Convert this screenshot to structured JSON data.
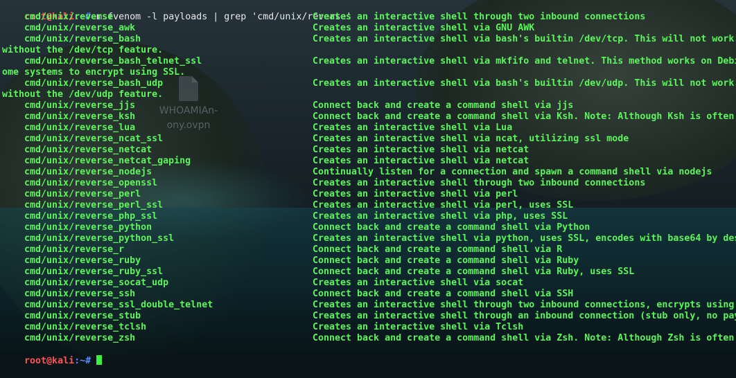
{
  "desktop_icon": {
    "label_lines": [
      "WHOAMIAn-",
      "ony.ovpn"
    ]
  },
  "terminal": {
    "prompt_user": "root@kali",
    "prompt_path": ":~#",
    "command": " msfvenom -l payloads | grep 'cmd/unix/reverse'",
    "lines": [
      {
        "payload": "    cmd/unix/reverse",
        "description": "Creates an interactive shell through two inbound connections"
      },
      {
        "payload": "    cmd/unix/reverse_awk",
        "description": "Creates an interactive shell via GNU AWK"
      },
      {
        "payload": "    cmd/unix/reverse_bash",
        "description": "Creates an interactive shell via bash's builtin /dev/tcp. This will not work"
      },
      {
        "wrap": "without the /dev/tcp feature."
      },
      {
        "payload": "    cmd/unix/reverse_bash_telnet_ssl",
        "description": "Creates an interactive shell via mkfifo and telnet. This method works on Debi"
      },
      {
        "wrap": "ome systems to encrypt using SSL."
      },
      {
        "payload": "    cmd/unix/reverse_bash_udp",
        "description": "Creates an interactive shell via bash's builtin /dev/udp. This will not work"
      },
      {
        "wrap": "without the /dev/udp feature."
      },
      {
        "payload": "    cmd/unix/reverse_jjs",
        "description": "Connect back and create a command shell via jjs"
      },
      {
        "payload": "    cmd/unix/reverse_ksh",
        "description": "Connect back and create a command shell via Ksh. Note: Although Ksh is often"
      },
      {
        "payload": "    cmd/unix/reverse_lua",
        "description": "Creates an interactive shell via Lua"
      },
      {
        "payload": "    cmd/unix/reverse_ncat_ssl",
        "description": "Creates an interactive shell via ncat, utilizing ssl mode"
      },
      {
        "payload": "    cmd/unix/reverse_netcat",
        "description": "Creates an interactive shell via netcat"
      },
      {
        "payload": "    cmd/unix/reverse_netcat_gaping",
        "description": "Creates an interactive shell via netcat"
      },
      {
        "payload": "    cmd/unix/reverse_nodejs",
        "description": "Continually listen for a connection and spawn a command shell via nodejs"
      },
      {
        "payload": "    cmd/unix/reverse_openssl",
        "description": "Creates an interactive shell through two inbound connections"
      },
      {
        "payload": "    cmd/unix/reverse_perl",
        "description": "Creates an interactive shell via perl"
      },
      {
        "payload": "    cmd/unix/reverse_perl_ssl",
        "description": "Creates an interactive shell via perl, uses SSL"
      },
      {
        "payload": "    cmd/unix/reverse_php_ssl",
        "description": "Creates an interactive shell via php, uses SSL"
      },
      {
        "payload": "    cmd/unix/reverse_python",
        "description": "Connect back and create a command shell via Python"
      },
      {
        "payload": "    cmd/unix/reverse_python_ssl",
        "description": "Creates an interactive shell via python, uses SSL, encodes with base64 by des"
      },
      {
        "payload": "    cmd/unix/reverse_r",
        "description": "Connect back and create a command shell via R"
      },
      {
        "payload": "    cmd/unix/reverse_ruby",
        "description": "Connect back and create a command shell via Ruby"
      },
      {
        "payload": "    cmd/unix/reverse_ruby_ssl",
        "description": "Connect back and create a command shell via Ruby, uses SSL"
      },
      {
        "payload": "    cmd/unix/reverse_socat_udp",
        "description": "Creates an interactive shell via socat"
      },
      {
        "payload": "    cmd/unix/reverse_ssh",
        "description": "Connect back and create a command shell via SSH"
      },
      {
        "payload": "    cmd/unix/reverse_ssl_double_telnet",
        "description": "Creates an interactive shell through two inbound connections, encrypts using"
      },
      {
        "payload": "    cmd/unix/reverse_stub",
        "description": "Creates an interactive shell through an inbound connection (stub only, no pay"
      },
      {
        "payload": "    cmd/unix/reverse_tclsh",
        "description": "Creates an interactive shell via Tclsh"
      },
      {
        "payload": "    cmd/unix/reverse_zsh",
        "description": "Connect back and create a command shell via Zsh. Note: Although Zsh is often"
      }
    ]
  },
  "colors": {
    "output_text": "#5cf55c",
    "prompt_user": "#ff5555",
    "prompt_path": "#5c8cff",
    "command_text": "#eaeaea",
    "cursor": "#3df03d"
  }
}
